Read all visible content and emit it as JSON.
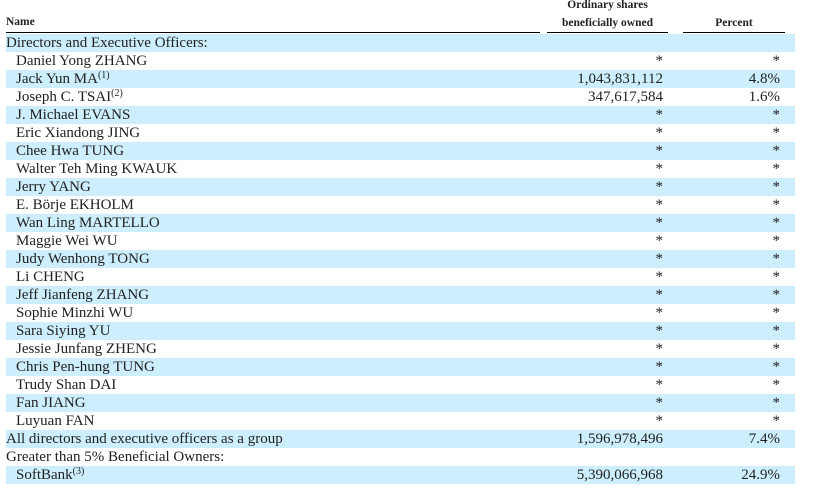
{
  "header": {
    "name": "Name",
    "shares_line1": "Ordinary shares",
    "shares_line2": "beneficially owned",
    "percent": "Percent"
  },
  "rows": [
    {
      "name": "Directors and Executive Officers:",
      "indent": false,
      "shares": "",
      "percent": ""
    },
    {
      "name": "Daniel Yong ZHANG",
      "indent": true,
      "shares": "*",
      "percent": "*"
    },
    {
      "name": "Jack Yun MA",
      "note": "(1)",
      "indent": true,
      "shares": "1,043,831,112",
      "percent": "4.8%"
    },
    {
      "name": "Joseph C. TSAI",
      "note": "(2)",
      "indent": true,
      "shares": "347,617,584",
      "percent": "1.6%"
    },
    {
      "name": "J. Michael EVANS",
      "indent": true,
      "shares": "*",
      "percent": "*"
    },
    {
      "name": "Eric Xiandong JING",
      "indent": true,
      "shares": "*",
      "percent": "*"
    },
    {
      "name": "Chee Hwa TUNG",
      "indent": true,
      "shares": "*",
      "percent": "*"
    },
    {
      "name": "Walter Teh Ming KWAUK",
      "indent": true,
      "shares": "*",
      "percent": "*"
    },
    {
      "name": "Jerry YANG",
      "indent": true,
      "shares": "*",
      "percent": "*"
    },
    {
      "name": "E. Börje EKHOLM",
      "indent": true,
      "shares": "*",
      "percent": "*"
    },
    {
      "name": "Wan Ling MARTELLO",
      "indent": true,
      "shares": "*",
      "percent": "*"
    },
    {
      "name": "Maggie Wei WU",
      "indent": true,
      "shares": "*",
      "percent": "*"
    },
    {
      "name": "Judy Wenhong TONG",
      "indent": true,
      "shares": "*",
      "percent": "*"
    },
    {
      "name": "Li CHENG",
      "indent": true,
      "shares": "*",
      "percent": "*"
    },
    {
      "name": "Jeff Jianfeng ZHANG",
      "indent": true,
      "shares": "*",
      "percent": "*"
    },
    {
      "name": "Sophie Minzhi WU",
      "indent": true,
      "shares": "*",
      "percent": "*"
    },
    {
      "name": "Sara Siying YU",
      "indent": true,
      "shares": "*",
      "percent": "*"
    },
    {
      "name": "Jessie Junfang ZHENG",
      "indent": true,
      "shares": "*",
      "percent": "*"
    },
    {
      "name": "Chris Pen-hung TUNG",
      "indent": true,
      "shares": "*",
      "percent": "*"
    },
    {
      "name": "Trudy Shan DAI",
      "indent": true,
      "shares": "*",
      "percent": "*"
    },
    {
      "name": "Fan JIANG",
      "indent": true,
      "shares": "*",
      "percent": "*"
    },
    {
      "name": "Luyuan FAN",
      "indent": true,
      "shares": "*",
      "percent": "*"
    },
    {
      "name": "All directors and executive officers as a group",
      "indent": false,
      "shares": "1,596,978,496",
      "percent": "7.4%"
    },
    {
      "name": "Greater than 5% Beneficial Owners:",
      "indent": false,
      "shares": "",
      "percent": ""
    },
    {
      "name": "SoftBank",
      "note": "(3)",
      "indent": true,
      "shares": "5,390,066,968",
      "percent": "24.9%"
    }
  ]
}
